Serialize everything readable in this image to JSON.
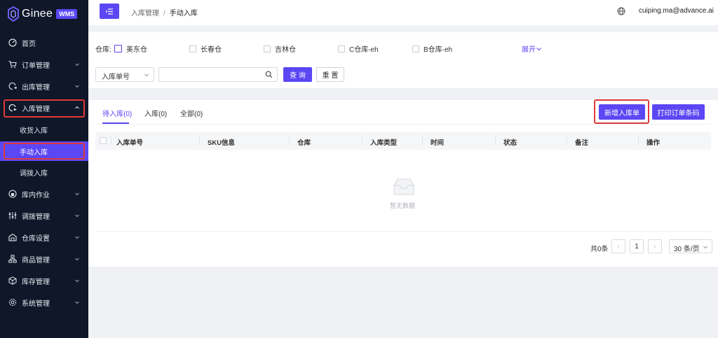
{
  "sidebar": {
    "logo_text": "Ginee",
    "logo_badge": "WMS",
    "items": [
      {
        "label": "首页",
        "icon": "dashboard-icon"
      },
      {
        "label": "订单管理",
        "icon": "cart-icon"
      },
      {
        "label": "出库管理",
        "icon": "outbound-icon"
      },
      {
        "label": "入库管理",
        "icon": "inbound-icon"
      },
      {
        "label": "库内作业",
        "icon": "warehouse-ops-icon"
      },
      {
        "label": "调拨管理",
        "icon": "transfer-icon"
      },
      {
        "label": "仓库设置",
        "icon": "warehouse-settings-icon"
      },
      {
        "label": "商品管理",
        "icon": "product-icon"
      },
      {
        "label": "库存管理",
        "icon": "inventory-icon"
      },
      {
        "label": "系统管理",
        "icon": "gear-icon"
      }
    ],
    "sub_items": [
      {
        "label": "收货入库"
      },
      {
        "label": "手动入库"
      },
      {
        "label": "调拨入库"
      }
    ]
  },
  "header": {
    "breadcrumb_parent": "入库管理",
    "breadcrumb_separator": "/",
    "breadcrumb_current": "手动入库",
    "user_email": "cuiping.ma@advance.ai"
  },
  "filter": {
    "warehouse_label": "仓库:",
    "warehouses": [
      "美东仓",
      "长春仓",
      "吉林仓",
      "C仓库-eh",
      "B仓库-eh"
    ],
    "expand_label": "展开",
    "search_field_selected": "入库单号",
    "search_value": "",
    "query_label": "查 询",
    "reset_label": "重 置"
  },
  "tabs": [
    {
      "label": "待入库(0)"
    },
    {
      "label": "入库(0)"
    },
    {
      "label": "全部(0)"
    }
  ],
  "actions": {
    "new_inbound_label": "新增入库单",
    "print_barcode_label": "打印订单条码"
  },
  "table": {
    "columns": [
      "入库单号",
      "SKU信息",
      "仓库",
      "入库类型",
      "时间",
      "状态",
      "备注",
      "操作"
    ],
    "empty_text": "暂无数据"
  },
  "pagination": {
    "total_text": "共0条",
    "current_page": "1",
    "page_size": "30 条/页",
    "prev": "‹",
    "next": "›"
  },
  "colors": {
    "accent": "#5b47f4",
    "sidebar_bg": "#0f1729",
    "highlight_red": "#e0393a"
  }
}
